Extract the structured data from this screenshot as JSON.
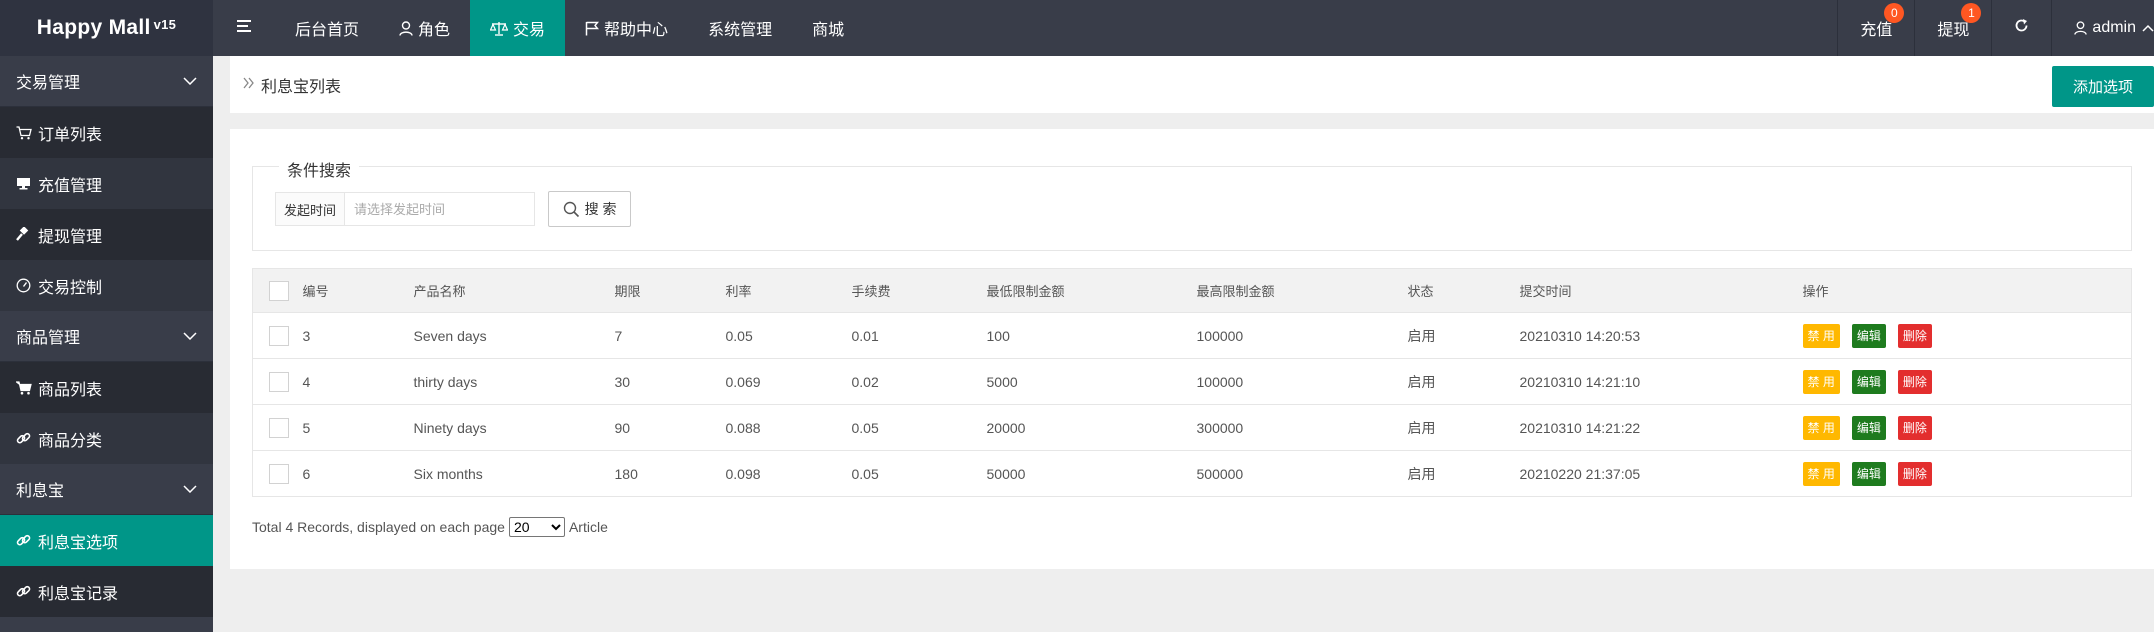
{
  "header": {
    "logo": "Happy Mall",
    "version": "v15",
    "nav": [
      {
        "label": "后台首页",
        "icon": ""
      },
      {
        "label": "角色",
        "icon": "user-icon"
      },
      {
        "label": "交易",
        "icon": "scale-icon",
        "active": true
      },
      {
        "label": "帮助中心",
        "icon": "flag-icon"
      },
      {
        "label": "系统管理",
        "icon": ""
      },
      {
        "label": "商城",
        "icon": ""
      }
    ],
    "recharge": {
      "label": "充值",
      "badge": "0"
    },
    "withdraw": {
      "label": "提现",
      "badge": "1"
    },
    "user": "admin"
  },
  "sidebar": {
    "trade": {
      "title": "交易管理",
      "items": [
        "订单列表",
        "充值管理",
        "提现管理",
        "交易控制"
      ]
    },
    "goods": {
      "title": "商品管理",
      "items": [
        "商品列表",
        "商品分类"
      ]
    },
    "lixibao": {
      "title": "利息宝",
      "items": [
        "利息宝选项",
        "利息宝记录"
      ]
    }
  },
  "breadcrumb": "利息宝列表",
  "add_button": "添加选项",
  "search": {
    "legend": "条件搜索",
    "addon": "发起时间",
    "placeholder": "请选择发起时间",
    "button": "搜 索"
  },
  "table": {
    "headers": [
      "编号",
      "产品名称",
      "期限",
      "利率",
      "手续费",
      "最低限制金额",
      "最高限制金额",
      "状态",
      "提交时间",
      "操作"
    ],
    "rows": [
      [
        "3",
        "Seven days",
        "7",
        "0.05",
        "0.01",
        "100",
        "100000",
        "启用",
        "20210310 14:20:53"
      ],
      [
        "4",
        "thirty days",
        "30",
        "0.069",
        "0.02",
        "5000",
        "100000",
        "启用",
        "20210310 14:21:10"
      ],
      [
        "5",
        "Ninety days",
        "90",
        "0.088",
        "0.05",
        "20000",
        "300000",
        "启用",
        "20210310 14:21:22"
      ],
      [
        "6",
        "Six months",
        "180",
        "0.098",
        "0.05",
        "50000",
        "500000",
        "启用",
        "20210220 21:37:05"
      ]
    ],
    "actions": {
      "disable": "禁 用",
      "edit": "编辑",
      "delete": "删除"
    }
  },
  "pager": {
    "prefix": "Total 4 Records, displayed on each page",
    "size": "20",
    "suffix": "Article"
  },
  "colors": {
    "accent": "#009688",
    "dark": "#393d49",
    "warn": "#ffb800",
    "edit": "#1e7b1e",
    "danger": "#e32e2e",
    "badge": "#ff5722"
  }
}
